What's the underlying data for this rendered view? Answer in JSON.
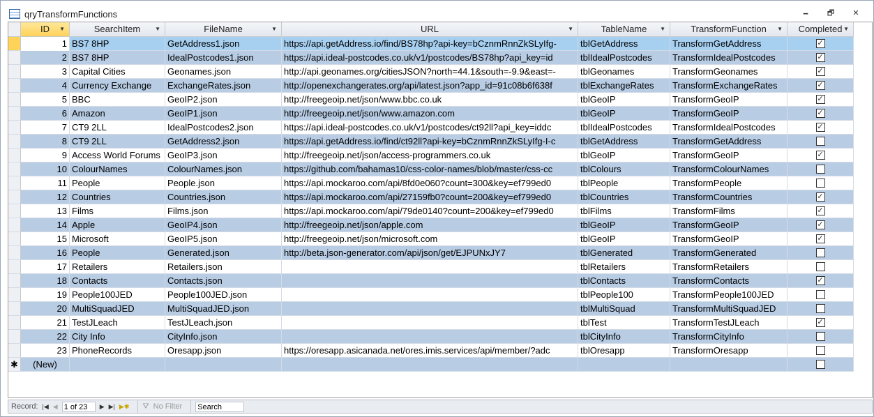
{
  "window": {
    "title": "qryTransformFunctions",
    "minimize": "🗕",
    "restore": "🗗",
    "close": "✕"
  },
  "columns": [
    "ID",
    "SearchItem",
    "FileName",
    "URL",
    "TableName",
    "TransformFunction",
    "Completed"
  ],
  "rows": [
    {
      "id": "1",
      "search": "BS7 8HP",
      "file": "GetAddress1.json",
      "url": "https://api.getAddress.io/find/BS78hp?api-key=bCznmRnnZkSLyIfg-",
      "table": "tblGetAddress",
      "func": "TransformGetAddress",
      "done": true
    },
    {
      "id": "2",
      "search": "BS7 8HP",
      "file": "IdealPostcodes1.json",
      "url": "https://api.ideal-postcodes.co.uk/v1/postcodes/BS78hp?api_key=id",
      "table": "tblIdealPostcodes",
      "func": "TransformIdealPostcodes",
      "done": true
    },
    {
      "id": "3",
      "search": "Capital Cities",
      "file": "Geonames.json",
      "url": "http://api.geonames.org/citiesJSON?north=44.1&south=-9.9&east=-",
      "table": "tblGeonames",
      "func": "TransformGeonames",
      "done": true
    },
    {
      "id": "4",
      "search": "Currency Exchange",
      "file": "ExchangeRates.json",
      "url": "http://openexchangerates.org/api/latest.json?app_id=91c08b6f638f",
      "table": "tblExchangeRates",
      "func": "TransformExchangeRates",
      "done": true
    },
    {
      "id": "5",
      "search": "BBC",
      "file": "GeoIP2.json",
      "url": "http://freegeoip.net/json/www.bbc.co.uk",
      "table": "tblGeoIP",
      "func": "TransformGeoIP",
      "done": true
    },
    {
      "id": "6",
      "search": "Amazon",
      "file": "GeoIP1.json",
      "url": "http://freegeoip.net/json/www.amazon.com",
      "table": "tblGeoIP",
      "func": "TransformGeoIP",
      "done": true
    },
    {
      "id": "7",
      "search": "CT9 2LL",
      "file": "IdealPostcodes2.json",
      "url": "https://api.ideal-postcodes.co.uk/v1/postcodes/ct92ll?api_key=iddc",
      "table": "tblIdealPostcodes",
      "func": "TransformIdealPostcodes",
      "done": true
    },
    {
      "id": "8",
      "search": "CT9 2LL",
      "file": "GetAddress2.json",
      "url": "https://api.getAddress.io/find/ct92ll?api-key=bCznmRnnZkSLyIfg-I-c",
      "table": "tblGetAddress",
      "func": "TransformGetAddress",
      "done": false
    },
    {
      "id": "9",
      "search": "Access World Forums",
      "file": "GeoIP3.json",
      "url": "http://freegeoip.net/json/access-programmers.co.uk",
      "table": "tblGeoIP",
      "func": "TransformGeoIP",
      "done": true
    },
    {
      "id": "10",
      "search": "ColourNames",
      "file": "ColourNames.json",
      "url": "https://github.com/bahamas10/css-color-names/blob/master/css-cc",
      "table": "tblColours",
      "func": "TransformColourNames",
      "done": false
    },
    {
      "id": "11",
      "search": "People",
      "file": "People.json",
      "url": "https://api.mockaroo.com/api/8fd0e060?count=300&key=ef799ed0",
      "table": "tblPeople",
      "func": "TransformPeople",
      "done": false
    },
    {
      "id": "12",
      "search": "Countries",
      "file": "Countries.json",
      "url": "https://api.mockaroo.com/api/27159fb0?count=200&key=ef799ed0",
      "table": "tblCountries",
      "func": "TransformCountries",
      "done": true
    },
    {
      "id": "13",
      "search": "Films",
      "file": "Films.json",
      "url": "https://api.mockaroo.com/api/79de0140?count=200&key=ef799ed0",
      "table": "tblFilms",
      "func": "TransformFilms",
      "done": true
    },
    {
      "id": "14",
      "search": "Apple",
      "file": "GeoIP4.json",
      "url": "http://freegeoip.net/json/apple.com",
      "table": "tblGeoIP",
      "func": "TransformGeoIP",
      "done": true
    },
    {
      "id": "15",
      "search": "Microsoft",
      "file": "GeoIP5.json",
      "url": "http://freegeoip.net/json/microsoft.com",
      "table": "tblGeoIP",
      "func": "TransformGeoIP",
      "done": true
    },
    {
      "id": "16",
      "search": "People",
      "file": "Generated.json",
      "url": "http://beta.json-generator.com/api/json/get/EJPUNxJY7",
      "table": "tblGenerated",
      "func": "TransformGenerated",
      "done": false
    },
    {
      "id": "17",
      "search": "Retailers",
      "file": "Retailers.json",
      "url": "",
      "table": "tblRetailers",
      "func": "TransformRetailers",
      "done": false
    },
    {
      "id": "18",
      "search": "Contacts",
      "file": "Contacts.json",
      "url": "",
      "table": "tblContacts",
      "func": "TransformContacts",
      "done": true
    },
    {
      "id": "19",
      "search": "People100JED",
      "file": "People100JED.json",
      "url": "",
      "table": "tblPeople100",
      "func": "TransformPeople100JED",
      "done": false
    },
    {
      "id": "20",
      "search": "MultiSquadJED",
      "file": "MultiSquadJED.json",
      "url": "",
      "table": "tblMultiSquad",
      "func": "TransformMultiSquadJED",
      "done": false
    },
    {
      "id": "21",
      "search": "TestJLeach",
      "file": "TestJLeach.json",
      "url": "",
      "table": "tblTest",
      "func": "TransformTestJLeach",
      "done": true
    },
    {
      "id": "22",
      "search": "City Info",
      "file": "CityInfo.json",
      "url": "",
      "table": "tblCityInfo",
      "func": "TransformCityInfo",
      "done": false
    },
    {
      "id": "23",
      "search": "PhoneRecords",
      "file": "Oresapp.json",
      "url": "https://oresapp.asicanada.net/ores.imis.services/api/member/?adc",
      "table": "tblOresapp",
      "func": "TransformOresapp",
      "done": false
    }
  ],
  "new_row": {
    "marker": "✱",
    "label": "(New)"
  },
  "status": {
    "record_label": "Record:",
    "record_value": "1 of 23",
    "filter": "No Filter",
    "search": "Search"
  }
}
